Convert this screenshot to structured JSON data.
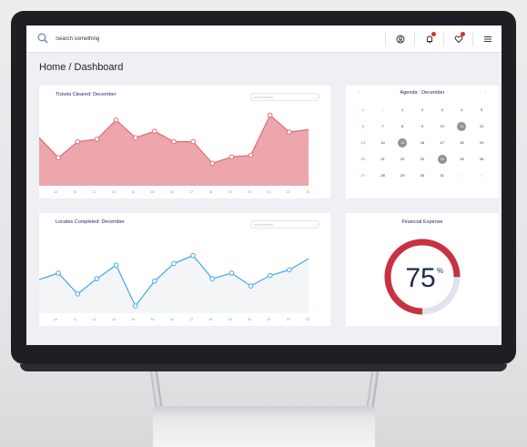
{
  "search": {
    "placeholder": "Search something"
  },
  "page_title": "Home / Dashboard",
  "tickets_card": {
    "title": "Tickets Cleared: December",
    "select": "sort by month"
  },
  "locates_card": {
    "title": "Locates Completed: December",
    "select": "sort by month"
  },
  "chart_data": [
    {
      "type": "area",
      "title": "Tickets Cleared: December",
      "x": [
        "10",
        "11",
        "12",
        "13",
        "14",
        "15",
        "16",
        "17",
        "18",
        "19",
        "20",
        "21",
        "22",
        "23"
      ],
      "values": [
        60,
        35,
        55,
        58,
        82,
        60,
        68,
        55,
        55,
        28,
        36,
        38,
        88,
        67,
        70
      ],
      "ylim": [
        0,
        100
      ],
      "color": "#e06a74"
    },
    {
      "type": "line",
      "title": "Locates Completed: December",
      "x": [
        "10",
        "11",
        "12",
        "13",
        "14",
        "15",
        "16",
        "17",
        "18",
        "19",
        "20",
        "21",
        "22",
        "23"
      ],
      "values": [
        42,
        50,
        24,
        43,
        60,
        9,
        40,
        62,
        72,
        43,
        50,
        34,
        47,
        54,
        68
      ],
      "ylim": [
        0,
        100
      ],
      "color": "#41a9e8"
    }
  ],
  "calendar": {
    "title": "Agenda : December",
    "prev": "‹",
    "next": "›",
    "weeks": [
      [
        {
          "d": "1",
          "s": "red"
        },
        {
          "d": "2",
          "s": "muted"
        },
        {
          "d": "1"
        },
        {
          "d": "2"
        },
        {
          "d": "3"
        },
        {
          "d": "4"
        },
        {
          "d": "5"
        }
      ],
      [
        {
          "d": "6",
          "s": "red"
        },
        {
          "d": "7"
        },
        {
          "d": "8"
        },
        {
          "d": "9"
        },
        {
          "d": "10"
        },
        {
          "d": "11",
          "s": "mark"
        },
        {
          "d": "12"
        }
      ],
      [
        {
          "d": "13",
          "s": "red"
        },
        {
          "d": "14"
        },
        {
          "d": "15",
          "s": "mark"
        },
        {
          "d": "16"
        },
        {
          "d": "17"
        },
        {
          "d": "18"
        },
        {
          "d": "19"
        }
      ],
      [
        {
          "d": "20",
          "s": "red"
        },
        {
          "d": "21"
        },
        {
          "d": "22"
        },
        {
          "d": "23"
        },
        {
          "d": "24",
          "s": "mark"
        },
        {
          "d": "25"
        },
        {
          "d": "26"
        }
      ],
      [
        {
          "d": "27",
          "s": "red"
        },
        {
          "d": "28"
        },
        {
          "d": "29"
        },
        {
          "d": "30"
        },
        {
          "d": "31"
        },
        {
          "d": "1",
          "s": "muted"
        },
        {
          "d": "2",
          "s": "muted"
        }
      ]
    ]
  },
  "financial": {
    "title": "Financial Expense",
    "value": "75",
    "unit": "%",
    "fraction": 0.75,
    "color": "#c8313f",
    "track": "#dfe4ec"
  },
  "icons": [
    "search-icon",
    "user-circle-icon",
    "bell-icon",
    "heart-icon",
    "menu-icon"
  ]
}
